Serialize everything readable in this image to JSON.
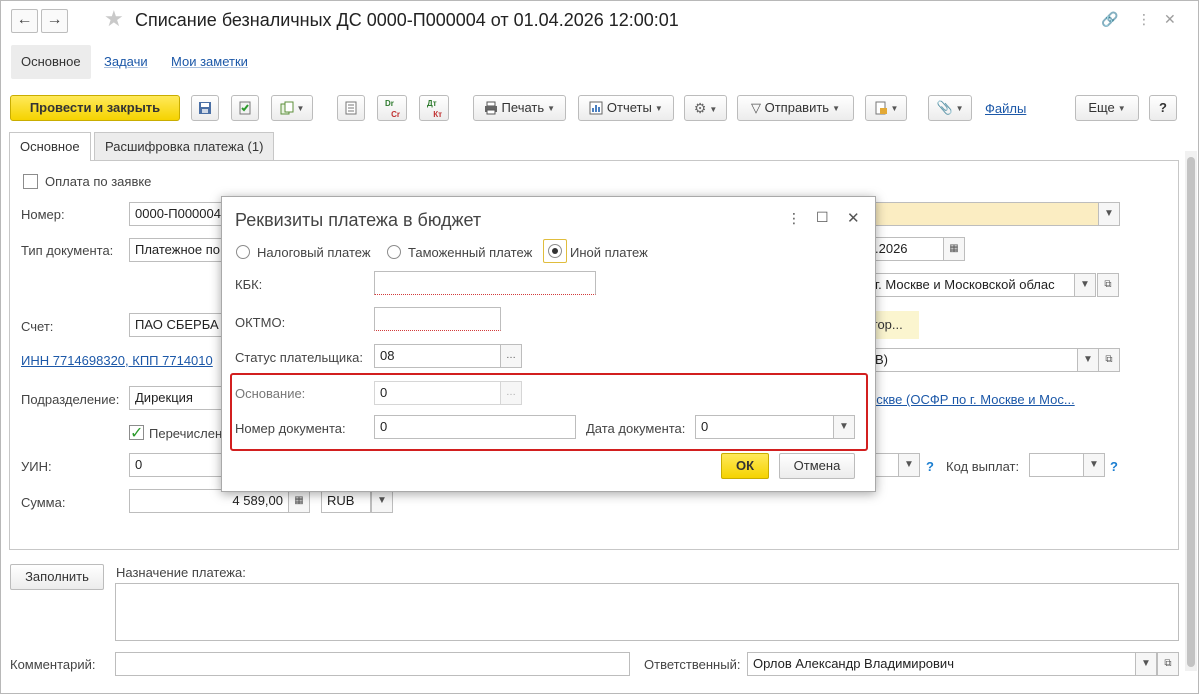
{
  "window": {
    "title": "Списание безналичных ДС 0000-П000004 от 01.04.2026 12:00:01",
    "back_glyph": "←",
    "forward_glyph": "→"
  },
  "sections": [
    "Основное",
    "Задачи",
    "Мои заметки"
  ],
  "toolbar": {
    "post_close": "Провести и закрыть",
    "print": "Печать",
    "reports": "Отчеты",
    "send": "Отправить",
    "files": "Файлы",
    "more": "Еще",
    "help": "?",
    "dt_cr_top": "Dr",
    "dt_cr_bottom": "Cr",
    "dt_kt_top": "Дт",
    "dt_kt_bottom": "Кт"
  },
  "form_tabs": [
    "Основное",
    "Расшифровка платежа (1)"
  ],
  "form": {
    "payment_on_request": "Оплата по заявке",
    "number_label": "Номер:",
    "number_value": "0000-П000004",
    "doc_type_label": "Тип документа:",
    "doc_type_value": "Платежное по",
    "date_value": ".2026",
    "account_label": "Счет:",
    "account_value": "ПАО СБЕРБА",
    "recipient_value": "г. Москве и Московской облас",
    "contract_hint": "гор...",
    "inn_link": "ИНН 7714698320, КПП 7714010",
    "rub_value": "В)",
    "division_label": "Подразделение:",
    "division_value": "Дирекция",
    "osfr_link": "оскве (ОСФР по г. Москве и Мос...",
    "transfer_label": "Перечислен",
    "uin_label": "УИН:",
    "uin_value": "0",
    "payout_code_label": "Код выплат:",
    "sum_label": "Сумма:",
    "sum_value": "4 589,00",
    "currency_value": "RUB",
    "fill_button": "Заполнить",
    "purpose_label": "Назначение платежа:",
    "comment_label": "Комментарий:",
    "responsible_label": "Ответственный:",
    "responsible_value": "Орлов Александр Владимирович"
  },
  "dialog": {
    "title": "Реквизиты платежа в бюджет",
    "radio_tax": "Налоговый платеж",
    "radio_customs": "Таможенный платеж",
    "radio_other": "Иной платеж",
    "selected_radio": "Иной платеж",
    "kbk_label": "КБК:",
    "kbk_value": "",
    "oktmo_label": "ОКТМО:",
    "oktmo_value": "",
    "payer_status_label": "Статус плательщика:",
    "payer_status_value": "08",
    "basis_label": "Основание:",
    "basis_value": "0",
    "doc_number_label": "Номер документа:",
    "doc_number_value": "0",
    "doc_date_label": "Дата документа:",
    "doc_date_value": "0",
    "ok_button": "ОК",
    "cancel_button": "Отмена"
  },
  "colors": {
    "primary_button": "#f5d300",
    "link": "#1c58a8",
    "highlight_box": "#d21f1f",
    "required_field": "#fbedc2"
  }
}
